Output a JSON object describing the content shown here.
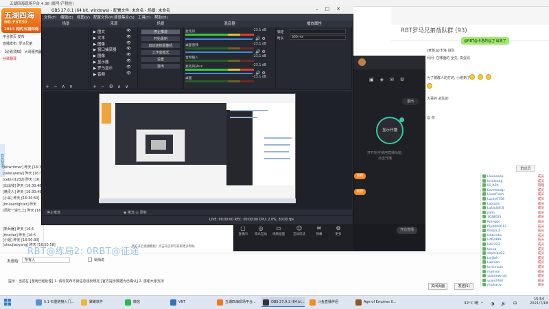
{
  "bg_window": {
    "title": "五湖四海现场平台 4.38 (版号/产税检)",
    "logo_main": "五湖四海",
    "logo_url": "HD.FXT30",
    "logo_sub": "2013 相约五湖四海",
    "left_rows": [
      "平台首页 发布",
      "直播发布: 罗马兄弟",
      "【必看须知】 大哥服务器",
      "谷歌翻译"
    ],
    "side_strip": "我的频道",
    "chat_log": [
      "[bitwritmer] 昨天 [16:30:02]",
      "[saiwuweiw] 昨天 [16:30:38]",
      "[cebini1232] 昨天 [16:30:41]",
      "[出出钱] 昨天 [16:30:48]",
      "[精灵人] 昨天 [16:30:49]",
      "[小哥] 昨天 [16:30:50]",
      "[bruiserlighter] 昨天",
      "[风吹一逆七上] 昨天 [16:4",
      "[新兵器] 昨天 [16:5",
      "[fineiter] 昨天 [16:5",
      "[小姐] 昨天 [16:50:30]",
      "[shoujiaoyang] 昨天 [16:50:58]"
    ]
  },
  "chat_panel": {
    "group_title": "RBT罗马兄弟战队群 (93)",
    "bubble_text": "@RBT@卡洛的@卫 出来了",
    "messages": [
      "[老板]@卡洛 战队",
      "问问: 在哪面的 全先, 捣蛋哥",
      "为了被群人的打的, 小刚到了 ",
      "大哥的 战队的",
      "@ 你"
    ],
    "group_button": "群成员",
    "members": [
      {
        "name": "Lleeeeeek",
        "tag": "成员"
      },
      {
        "name": "loveleadg",
        "tag": "成员"
      },
      {
        "name": "lili_lt2lt",
        "tag": "管理"
      },
      {
        "name": "Loveleadgr",
        "tag": "成员"
      },
      {
        "name": "LiusoFlash",
        "tag": "成员"
      },
      {
        "name": "Lucky0758",
        "tag": "成员"
      },
      {
        "name": "Laolashi",
        "tag": "成员"
      },
      {
        "name": "Lufaulb6.8",
        "tag": "成员"
      },
      {
        "name": "jialin",
        "tag": "成员"
      },
      {
        "name": "1638026",
        "tag": "成员"
      },
      {
        "name": "Kpinggo",
        "tag": "成员"
      },
      {
        "name": "f5p0000012",
        "tag": "成员"
      },
      {
        "name": "Koopa_b",
        "tag": "成员"
      },
      {
        "name": "lxhbssibu",
        "tag": "成员"
      },
      {
        "name": "lxf62999",
        "tag": "成员"
      },
      {
        "name": "lx62223",
        "tag": "成员"
      },
      {
        "name": "kcsup",
        "tag": "成员"
      },
      {
        "name": "seplhiao03",
        "tag": "成员"
      },
      {
        "name": "Leijib9",
        "tag": "成员"
      },
      {
        "name": "Luonian",
        "tag": "成员"
      },
      {
        "name": "lovsinvuie",
        "tag": "成员"
      },
      {
        "name": "madvon",
        "tag": "成员"
      },
      {
        "name": "yuanjewmdt",
        "tag": "成员"
      },
      {
        "name": "yuan2060",
        "tag": "成员"
      },
      {
        "name": "mjuhasiy",
        "tag": "成员"
      }
    ],
    "send_label": "发送给:",
    "send_target": "所有人",
    "private_label": "悄悄说",
    "tip": "提示：当前在 [游戏已经处理]  1. 请勿发布不良信息违反规定 [官方提示数据为已确认]  2. 感谢大家支持",
    "close_btn": "关闭页面",
    "send_btn": "发送(S)"
  },
  "live_app": {
    "exit_label": "退出",
    "start_circle": "显示开播",
    "circle_sub": "开开始可使用直播功能,",
    "circle_sub2": "点击开播",
    "pill1": "新建",
    "pill2": "新建",
    "start_btn": "开始直播",
    "tools": [
      {
        "icon": "▢",
        "label": "直播间"
      },
      {
        "icon": "◎",
        "label": "观众互动"
      },
      {
        "icon": "▭",
        "label": "视频画面"
      },
      {
        "icon": "☺",
        "label": "互动玩法"
      },
      {
        "icon": "✉",
        "label": "弹幕"
      },
      {
        "icon": "⚙",
        "label": "更多"
      }
    ]
  },
  "obs": {
    "title": "OBS 27.0.1 (64 bit, windows) - 配置文件: 未命名 - 场景: 未命名",
    "menus": [
      "文件(F)",
      "编辑(E)",
      "视图(V)",
      "配置文件(P)",
      "场景集合(S)",
      "工具(T)",
      "帮助(H)"
    ],
    "docks": {
      "scenes": "场景",
      "sources": "来源",
      "transitions": "场景",
      "mixer": "混音器",
      "properties": "播放属性"
    },
    "sources": [
      "图文",
      "文本",
      "图像",
      "窗口捕获器",
      "图像",
      "显示器",
      "罗马显示",
      "音频"
    ],
    "transitions": [
      "停止推流",
      "开始录制",
      "启动虚拟摄像机",
      "工作室模式",
      "设置",
      "退出"
    ],
    "mixer": [
      {
        "label": "麦克风",
        "db": "-23.1 dB"
      },
      {
        "label": "桌面音频",
        "db": "-23.1 dB"
      },
      {
        "label": "音频输入",
        "db": "-23.1 dB"
      },
      {
        "label": "麦克风/Aux",
        "db": "-23.1 dB"
      },
      {
        "label": "桌面",
        "db": "-23.1 dB"
      }
    ],
    "prop_label1": "锁定",
    "prop_label2": "时长",
    "prop_value2": "300 ms",
    "preview_label": "停止推流",
    "bottom_left": "◉ 推流   ◎ 录制",
    "status_text": "LIVE: 00:00:00   REC: 00:00:00   CPU: 2.0%, 30.00 fps"
  },
  "overlay": {
    "watermark": "RBT@练局2: 0RBT@征途",
    "notify": "我已开启直播模板? 点击开启即可获取更多帮助"
  },
  "taskbar": {
    "items": [
      {
        "label": "5.1 石墨链接入门...",
        "color": "#5a8fd8"
      },
      {
        "label": "聚聚软件",
        "color": "#f2b533"
      },
      {
        "label": "微信",
        "color": "#2db84a"
      },
      {
        "label": "VNT",
        "color": "#2f72c7"
      },
      {
        "label": "五湖四海现场平台...",
        "color": "#f07a22"
      },
      {
        "label": "OBS 27.0.1 (64 bi...",
        "color": "#333333"
      },
      {
        "label": "斗鱼直播伴侣",
        "color": "#f58a1f"
      },
      {
        "label": "Age of Empires II...",
        "color": "#8a5a2a"
      }
    ],
    "temp": "32°C 晴",
    "time": "15:54",
    "date": "2021/7/18"
  },
  "colors": {
    "obs_bg": "#2b2e38",
    "accent_green": "#38c6a5",
    "live_orange": "#f58a1f",
    "chat_bubble": "#9eea6a"
  }
}
